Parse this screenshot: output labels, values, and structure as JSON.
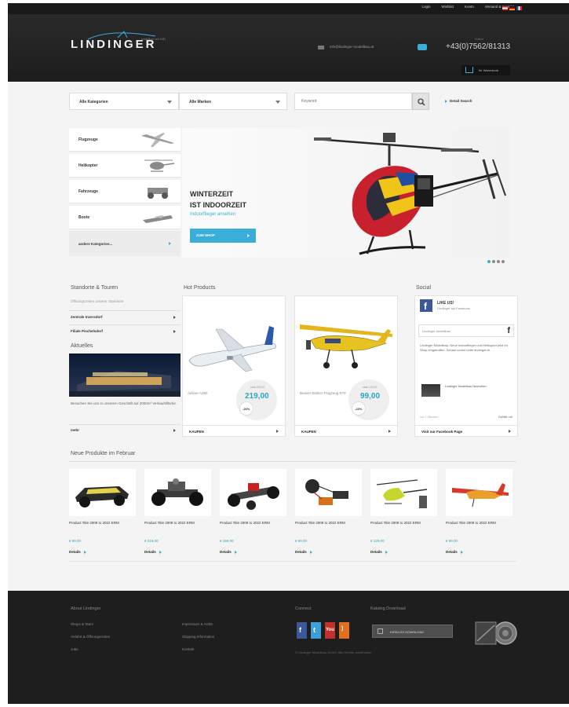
{
  "top_links": [
    "Login",
    "Wishlist",
    "Konto",
    "Versand & Kontakt"
  ],
  "logo": {
    "text": "LINDINGER",
    "tagline": "modellbau seit 1981"
  },
  "header": {
    "email": "info@lindinger-modellbau.at",
    "phone_label": "Hotline",
    "phone": "+43(0)7562/81313",
    "cart_label": "Ihr Warenkorb"
  },
  "search": {
    "category_select": "Alle Kategorien",
    "brand_select": "Alle Marken",
    "placeholder": "Keyword",
    "detail_search": "Detail Search"
  },
  "categories": [
    "Flugzeuge",
    "Helikopter",
    "Fahrzeuge",
    "Boote"
  ],
  "categories_more": "andere Kategorien...",
  "hero": {
    "line1": "WINTERZEIT",
    "line2": "IST INDOORZEIT",
    "sub": "Indoorflieger ansehen",
    "button": "ZUM SHOP"
  },
  "standorte": {
    "title": "Standorte & Touren",
    "desc": "Öffnungszeiten unserer Standorte",
    "links": [
      "Zentrale Inzersdorf",
      "Filiale Pischelsdorf"
    ]
  },
  "aktuelles": {
    "title": "Aktuelles",
    "desc": "Besuchen Sie uns in unserem Geschäft auf 2000m² Verkaufsfläche.",
    "more": "mehr"
  },
  "hot_products": {
    "title": "Hot Products",
    "items": [
      {
        "desc": "Airliner A380",
        "old_price": "statt 299,00",
        "price": "219,00",
        "discount": "-26%",
        "buy": "KAUFEN"
      },
      {
        "desc": "Beaver Elektro Flugzeug RTF",
        "old_price": "statt 129,00",
        "price": "99,00",
        "discount": "-23%",
        "buy": "KAUFEN"
      }
    ]
  },
  "social": {
    "title": "Social",
    "like": "LIKE US!",
    "like_sub": "Lindinger auf Facebook",
    "search": "Lindinger Modellbau",
    "post": "Lindinger Modellbau: Neue Indoorflieger und Helikopter jetzt im Shop eingetroffen. Schaut vorbei unter lindinger.at.",
    "thumb_text": "Lindinger Modellbau Neuheiten",
    "date": "vor 2 Stunden",
    "likes": "Gefällt mir",
    "visit": "Visit our Facebook Page"
  },
  "new_products": {
    "title": "Neue Produkte im Februar",
    "items": [
      {
        "name": "Product Title 2009 to 2022 ERM",
        "price": "€ 89,00",
        "details": "Details"
      },
      {
        "name": "Product Title 2009 to 2022 ERM",
        "price": "€ 219,00",
        "details": "Details"
      },
      {
        "name": "Product Title 2009 to 2022 ERM",
        "price": "€ 159,00",
        "details": "Details"
      },
      {
        "name": "Product Title 2009 to 2022 ERM",
        "price": "€ 69,00",
        "details": "Details"
      },
      {
        "name": "Product Title 2009 to 2022 ERM",
        "price": "€ 129,00",
        "details": "Details"
      },
      {
        "name": "Product Title 2009 to 2022 ERM",
        "price": "€ 99,00",
        "details": "Details"
      }
    ]
  },
  "footer": {
    "col1_title": "About Lindinger",
    "col1_links": [
      "Shops & Team",
      "Anfahrt & Öffnungszeiten",
      "Jobs"
    ],
    "col2_links": [
      "Impressum & AGBs",
      "Shipping Information",
      "Kontakt"
    ],
    "connect": "Connect",
    "catalog": "Katalog Download",
    "download": "KATALOG DOWNLOAD",
    "note": "© Lindinger Modellbau GmbH. Alle Rechte vorbehalten."
  },
  "colors": {
    "accent": "#3aaed8",
    "header_bg": "#222222",
    "footer_bg": "#1e1e1e"
  },
  "icons": [
    "search-icon",
    "cart-icon",
    "email-icon",
    "chat-icon",
    "chevron-right-icon",
    "facebook-icon",
    "twitter-icon",
    "youtube-icon",
    "rss-icon"
  ]
}
